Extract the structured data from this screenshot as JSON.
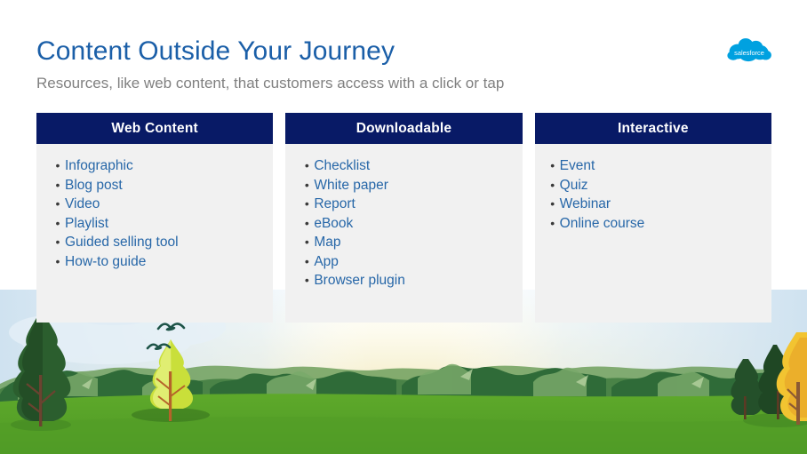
{
  "header": {
    "title": "Content Outside Your Journey",
    "subtitle": "Resources, like web content, that customers access with a click or tap",
    "title_color": "#1B5FA8",
    "subtitle_color": "#808080"
  },
  "brand": {
    "name": "salesforce",
    "logo_icon": "salesforce-cloud-icon",
    "logo_color": "#00A1E0"
  },
  "theme": {
    "card_header_bg": "#081A66",
    "card_body_bg": "#F1F1F1",
    "list_text_color": "#2767A8",
    "bullet_color": "#3A3A3A"
  },
  "cards": [
    {
      "title": "Web Content",
      "items": [
        "Infographic",
        "Blog post",
        "Video",
        "Playlist",
        "Guided selling tool",
        "How-to guide"
      ]
    },
    {
      "title": "Downloadable",
      "items": [
        "Checklist",
        "White paper",
        "Report",
        "eBook",
        "Map",
        "App",
        "Browser plugin"
      ]
    },
    {
      "title": "Interactive",
      "items": [
        "Event",
        "Quiz",
        "Webinar",
        "Online course"
      ]
    }
  ],
  "scenery": {
    "description": "illustrated landscape with trees, hills, grass field and birds",
    "sky_top_color": "#FFFFFF",
    "sky_glow_color": "#FAF4D2",
    "sky_blue_color": "#DCEAF5",
    "grass_color": "#5CA52B",
    "hill_color": "#2F6B38",
    "bird_color": "#1E5448",
    "autumn_tree_color": "#F2C431"
  }
}
